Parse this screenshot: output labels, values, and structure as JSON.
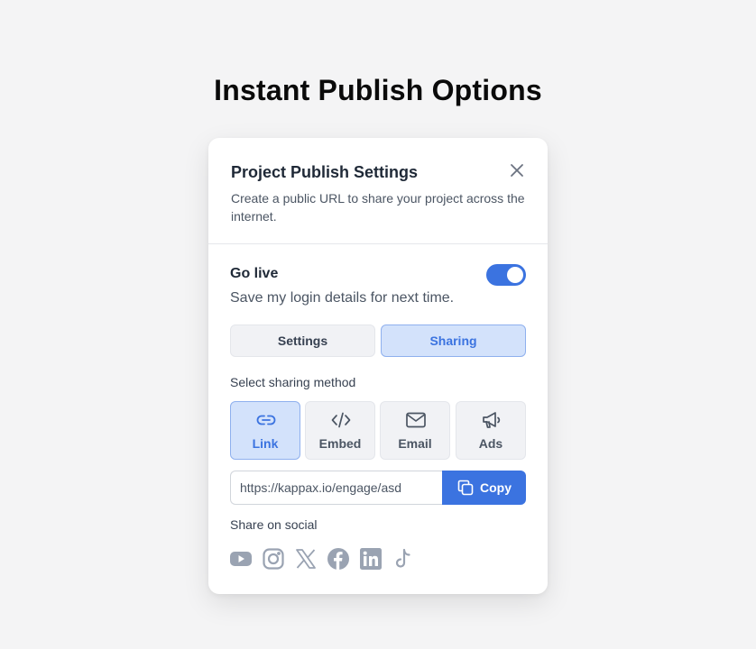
{
  "page": {
    "title": "Instant Publish Options"
  },
  "modal": {
    "title": "Project Publish Settings",
    "description": "Create a public URL to share your project across the internet.",
    "close_icon": "close-icon"
  },
  "go_live": {
    "title": "Go live",
    "subtitle": "Save my login details for next time.",
    "enabled": true
  },
  "tabs": [
    {
      "label": "Settings",
      "active": false
    },
    {
      "label": "Sharing",
      "active": true
    }
  ],
  "sharing": {
    "section_label": "Select sharing method",
    "methods": [
      {
        "label": "Link",
        "icon": "link-icon",
        "active": true
      },
      {
        "label": "Embed",
        "icon": "code-icon",
        "active": false
      },
      {
        "label": "Email",
        "icon": "mail-icon",
        "active": false
      },
      {
        "label": "Ads",
        "icon": "megaphone-icon",
        "active": false
      }
    ],
    "url_value": "https://kappax.io/engage/asd",
    "copy_label": "Copy",
    "copy_icon": "copy-icon"
  },
  "social": {
    "label": "Share on social",
    "networks": [
      {
        "name": "YouTube",
        "icon": "youtube-icon"
      },
      {
        "name": "Instagram",
        "icon": "instagram-icon"
      },
      {
        "name": "X",
        "icon": "x-icon"
      },
      {
        "name": "Facebook",
        "icon": "facebook-icon"
      },
      {
        "name": "LinkedIn",
        "icon": "linkedin-icon"
      },
      {
        "name": "TikTok",
        "icon": "tiktok-icon"
      }
    ]
  },
  "colors": {
    "accent": "#3b73e0",
    "accent_light": "#d3e2fb",
    "background": "#f4f4f5",
    "muted_icon": "#9aa3b2"
  }
}
